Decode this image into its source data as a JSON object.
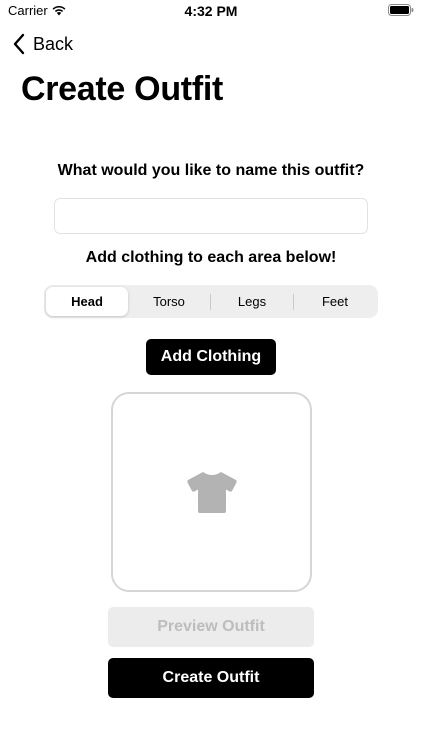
{
  "status_bar": {
    "carrier": "Carrier",
    "time": "4:32 PM",
    "wifi_icon": "wifi-icon",
    "battery_icon": "battery-icon"
  },
  "nav": {
    "back_label": "Back",
    "back_icon": "chevron-left-icon"
  },
  "page": {
    "title": "Create Outfit"
  },
  "form": {
    "name_question": "What would you like to name this outfit?",
    "name_value": "",
    "name_placeholder": "",
    "instruction": "Add clothing to each area below!",
    "segments": [
      {
        "label": "Head",
        "selected": true
      },
      {
        "label": "Torso",
        "selected": false
      },
      {
        "label": "Legs",
        "selected": false
      },
      {
        "label": "Feet",
        "selected": false
      }
    ],
    "add_clothing_label": "Add Clothing",
    "clothing_placeholder_icon": "tshirt-icon"
  },
  "actions": {
    "preview_label": "Preview Outfit",
    "create_label": "Create Outfit"
  },
  "colors": {
    "primary": "#000000",
    "disabled_bg": "#ececec",
    "disabled_text": "#bdbdbd",
    "icon_gray": "#b3b3b3"
  }
}
